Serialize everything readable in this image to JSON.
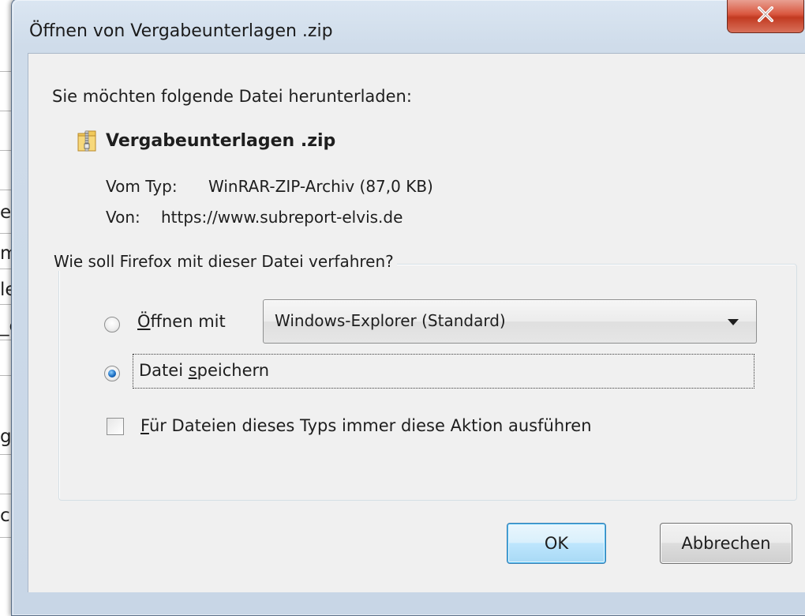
{
  "background": {
    "fragments": [
      "ei",
      "m",
      "le",
      "_c",
      "ge",
      "c"
    ]
  },
  "dialog": {
    "title": "Öffnen von Vergabeunterlagen .zip",
    "close_symbol": "X",
    "prompt": "Sie möchten folgende Datei herunterladen:",
    "file": {
      "icon": "zip-folder-icon",
      "name": "Vergabeunterlagen .zip",
      "type_label": "Vom Typ:",
      "type_value": "WinRAR-ZIP-Archiv (87,0 KB)",
      "from_label": "Von:",
      "from_value": "https://www.subreport-elvis.de"
    },
    "action_group": {
      "legend": "Wie soll Firefox mit dieser Datei verfahren?",
      "open_with": {
        "label_underlined": "Ö",
        "label_rest": "ffnen mit",
        "selected": false,
        "app": "Windows-Explorer (Standard)"
      },
      "save_file": {
        "label_before": "Datei ",
        "label_underlined": "s",
        "label_after": "peichern",
        "selected": true
      },
      "always_do": {
        "label_underlined": "F",
        "label_rest": "ür Dateien dieses Typs immer diese Aktion ausführen",
        "checked": false
      }
    },
    "buttons": {
      "ok": "OK",
      "cancel": "Abbrechen"
    }
  },
  "colors": {
    "frame": "#cfdcea",
    "client": "#f0f0f0",
    "close": "#c8442c",
    "ok_accent": "#3c7fb1"
  }
}
